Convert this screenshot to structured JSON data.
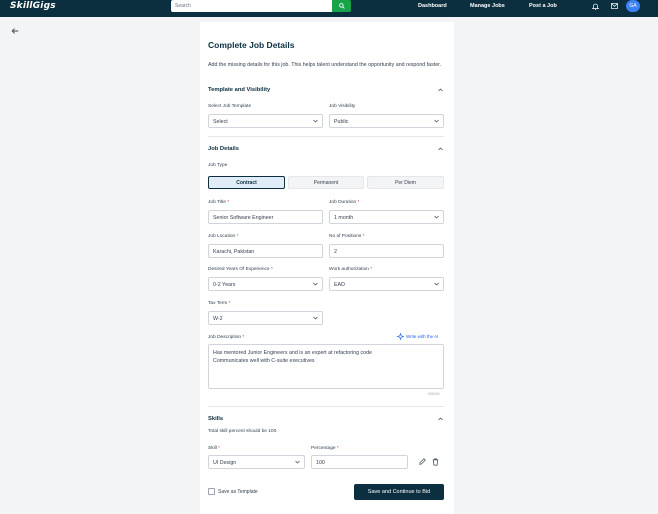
{
  "nav": {
    "logo": "SkillGigs",
    "search_placeholder": "Search",
    "links": [
      "Dashboard",
      "Manage Jobs",
      "Post a Job"
    ],
    "avatar_initials": "GA"
  },
  "page": {
    "title": "Complete Job Details",
    "intro": "Add the missing details for this job. This helps talent understand the opportunity and respond faster."
  },
  "template_section": {
    "title": "Template and Visibility",
    "template_label": "Select Job Template",
    "template_value": "Select",
    "visibility_label": "Job Visibility",
    "visibility_value": "Public"
  },
  "job_details": {
    "title": "Job Details",
    "job_type_label": "Job Type",
    "job_types": [
      "Contract",
      "Permanent",
      "Per Diem"
    ],
    "active_job_type": "Contract",
    "job_title_label": "Job Title",
    "job_title_value": "Senior Software Engineer",
    "duration_label": "Job Duration",
    "duration_value": "1 month",
    "location_label": "Job Location",
    "location_value": "Karachi, Pakistan",
    "positions_label": "No of Positions",
    "positions_value": "2",
    "experience_label": "Desired Years Of Experience",
    "experience_value": "0-2 Years",
    "work_auth_label": "Work authorization",
    "work_auth_value": "EAD",
    "tax_term_label": "Tax Term",
    "tax_term_value": "W-2",
    "description_label": "Job Description",
    "ai_link": "Write with the AI",
    "description_lines": [
      "Has mentored Junior Engineers and is an expert at refactoring code",
      "Communicates well with C-suite executives"
    ],
    "char_counter": "0/5000"
  },
  "skills": {
    "title": "Skills",
    "note": "Total skill percent should be 100.",
    "skill_label": "Skill",
    "skill_value": "UI Design",
    "percentage_label": "Percentage",
    "percentage_value": "100"
  },
  "footer": {
    "save_template_label": "Save as Template",
    "submit_label": "Save and Continue to Bid"
  },
  "colors": {
    "nav_bg": "#0b2f3f",
    "search_button": "#16a34a",
    "accent": "#2563eb",
    "required": "#dc2626"
  },
  "icons": [
    "search-icon",
    "bell-icon",
    "mail-icon",
    "back-arrow-icon",
    "chevron-up-icon",
    "chevron-down-icon",
    "sparkle-icon",
    "pencil-icon",
    "trash-icon"
  ]
}
